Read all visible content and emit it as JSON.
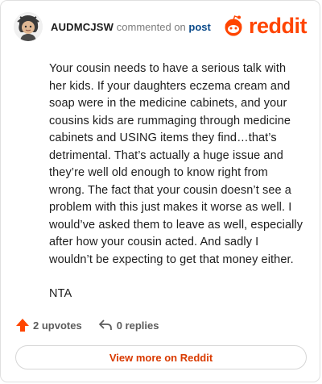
{
  "header": {
    "username": "AUDMCJSW",
    "action_text": "commented on",
    "post_link": "post",
    "logo_text": "reddit"
  },
  "comment": {
    "paragraphs": [
      "Your cousin needs to have a serious talk with her kids. If your daughters eczema cream and soap were in the medicine cabinets, and your cousins kids are rummaging through medicine cabinets and USING items they find…that’s detrimental. That’s actually a huge issue and they’re well old enough to know right from wrong. The fact that your cousin doesn’t see a problem with this just makes it worse as well. I would’ve asked them to leave as well, especially after how your cousin acted. And sadly I wouldn’t be expecting to get that money either.",
      "NTA"
    ]
  },
  "footer": {
    "upvotes": "2 upvotes",
    "replies": "0 replies"
  },
  "cta": {
    "label": "View more on Reddit"
  },
  "colors": {
    "brand": "#ff4500",
    "cta_text": "#d93a00",
    "post_link": "#0a4a8a"
  }
}
